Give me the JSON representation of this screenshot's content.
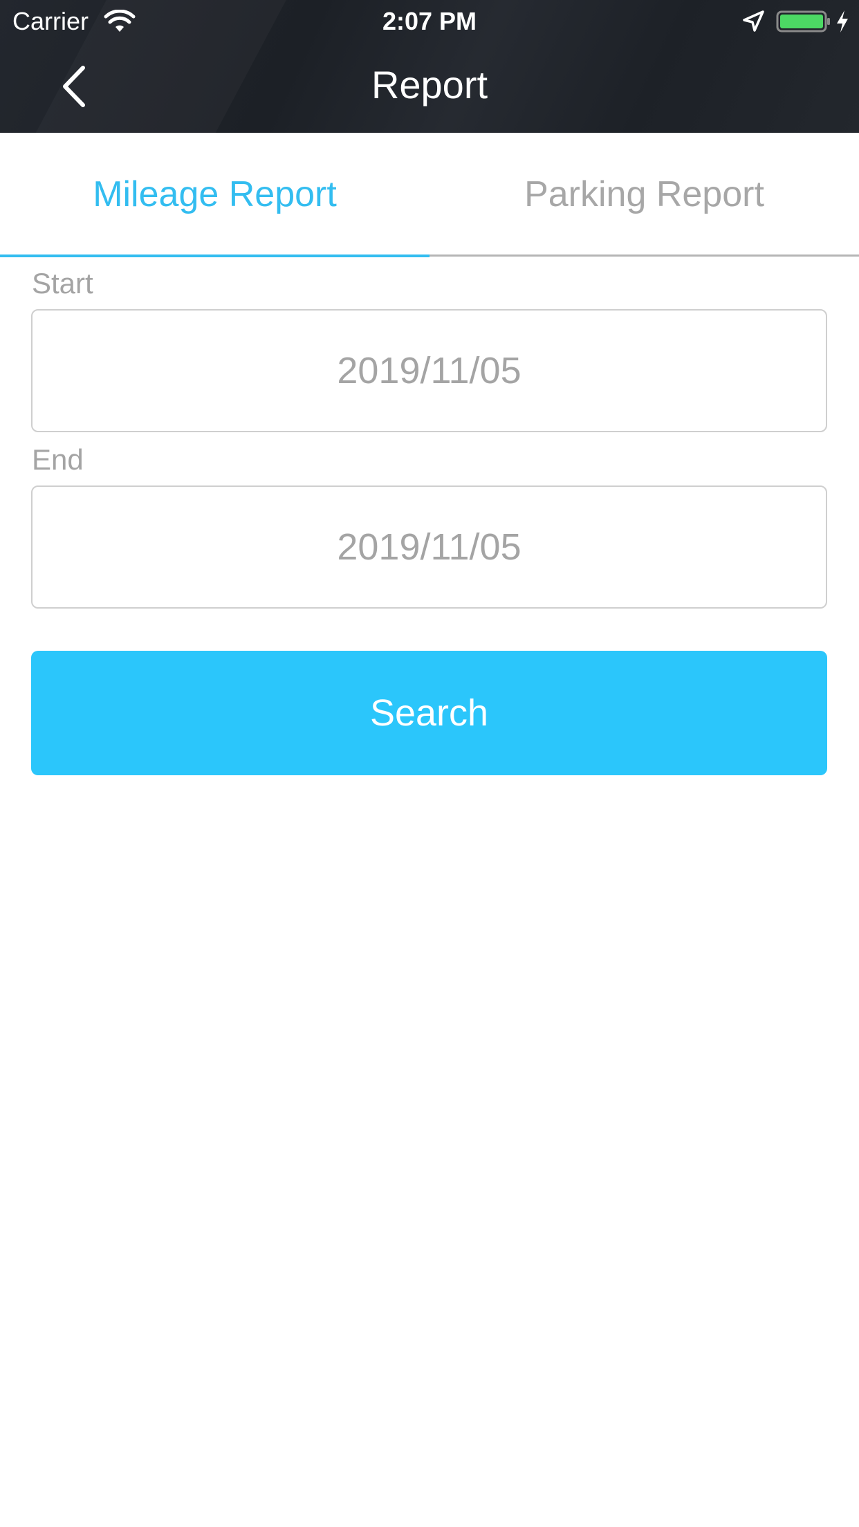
{
  "status_bar": {
    "carrier": "Carrier",
    "time": "2:07 PM",
    "battery_color": "#4cd964"
  },
  "nav": {
    "title": "Report",
    "back_icon": "chevron-left-icon"
  },
  "tabs": [
    {
      "label": "Mileage Report",
      "active": true
    },
    {
      "label": "Parking Report",
      "active": false
    }
  ],
  "form": {
    "start_label": "Start",
    "start_value": "2019/11/05",
    "end_label": "End",
    "end_value": "2019/11/05",
    "search_label": "Search"
  },
  "colors": {
    "accent": "#2bc6fb",
    "tab_active": "#33bdf0",
    "tab_inactive": "#a7a7a7",
    "header_bg": "#1f2329"
  }
}
